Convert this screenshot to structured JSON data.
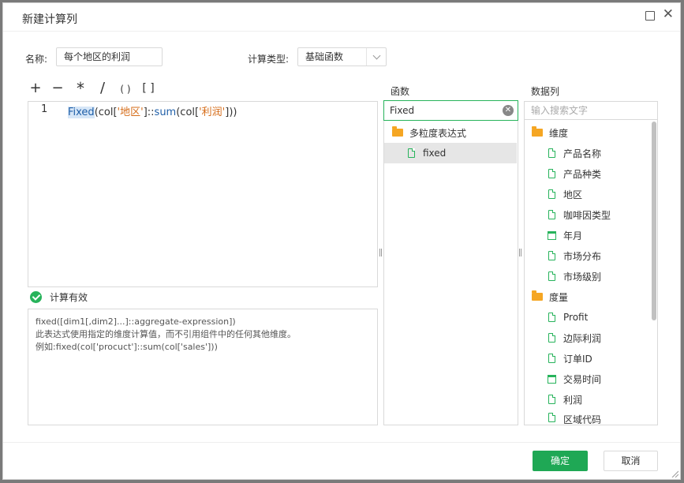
{
  "dialog": {
    "title": "新建计算列",
    "name_label": "名称:",
    "name_value": "每个地区的利润",
    "type_label": "计算类型:",
    "type_value": "基础函数"
  },
  "toolbar": {
    "plus": "+",
    "minus": "−",
    "multiply": "*",
    "divide": "/",
    "parens": "( )",
    "brackets": "[ ]"
  },
  "editor": {
    "line_number": "1",
    "tokens": [
      "Fixed",
      "(col[",
      "'地区'",
      "]::",
      "sum",
      "(col[",
      "'利润'",
      "]))"
    ]
  },
  "validation": {
    "text": "计算有效"
  },
  "help": {
    "lines": [
      "fixed([dim1[,dim2]...]::aggregate-expression])",
      "此表达式使用指定的维度计算值，而不引用组件中的任何其他维度。",
      "例如:fixed(col['procuct']::sum(col['sales']))"
    ]
  },
  "functions": {
    "header": "函数",
    "search_value": "Fixed",
    "tree": [
      {
        "label": "多粒度表达式",
        "icon": "folder-open-icon"
      },
      {
        "label": "fixed",
        "icon": "function-doc-icon",
        "selected": true
      }
    ]
  },
  "columns": {
    "header": "数据列",
    "search_placeholder": "输入搜索文字",
    "groups": [
      {
        "label": "维度",
        "items": [
          {
            "label": "产品名称",
            "icon": "doc-icon"
          },
          {
            "label": "产品种类",
            "icon": "doc-icon"
          },
          {
            "label": "地区",
            "icon": "doc-icon"
          },
          {
            "label": "咖啡因类型",
            "icon": "doc-icon"
          },
          {
            "label": "年月",
            "icon": "calendar-icon"
          },
          {
            "label": "市场分布",
            "icon": "doc-icon"
          },
          {
            "label": "市场级别",
            "icon": "doc-icon"
          }
        ]
      },
      {
        "label": "度量",
        "items": [
          {
            "label": "Profit",
            "icon": "doc-icon"
          },
          {
            "label": "边际利润",
            "icon": "doc-icon"
          },
          {
            "label": "订单ID",
            "icon": "doc-icon"
          },
          {
            "label": "交易时间",
            "icon": "calendar-icon"
          },
          {
            "label": "利润",
            "icon": "doc-icon"
          },
          {
            "label": "区域代码",
            "icon": "doc-icon"
          }
        ]
      }
    ]
  },
  "footer": {
    "ok_label": "确定",
    "cancel_label": "取消"
  },
  "colors": {
    "accent": "#1fa855",
    "keyword": "#1f5fa8",
    "string": "#d66d1a",
    "folder": "#f5a623"
  }
}
